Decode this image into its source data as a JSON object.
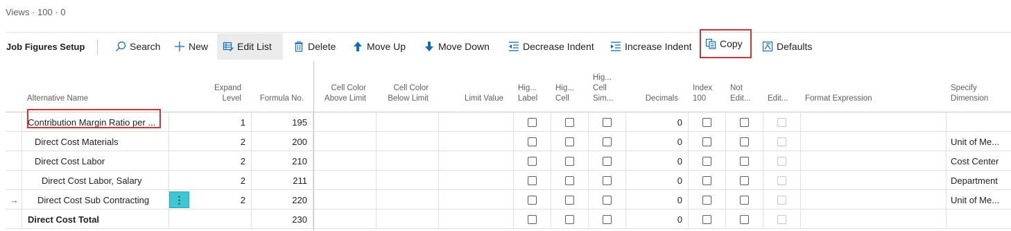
{
  "views": "Views · 100 · 0",
  "toolbar": {
    "title": "Job Figures Setup",
    "search": "Search",
    "new": "New",
    "edit_list": "Edit List",
    "delete": "Delete",
    "move_up": "Move Up",
    "move_down": "Move Down",
    "decrease_indent": "Decrease Indent",
    "increase_indent": "Increase Indent",
    "copy": "Copy",
    "defaults": "Defaults"
  },
  "columns": {
    "alt_name": "Alternative Name",
    "expand_level": [
      "Expand",
      "Level"
    ],
    "formula_no": "Formula No.",
    "cell_color_above": [
      "Cell Color",
      "Above Limit"
    ],
    "cell_color_below": [
      "Cell Color",
      "Below Limit"
    ],
    "limit_value": "Limit Value",
    "hig_label": [
      "Hig...",
      "Label"
    ],
    "hig_cell": [
      "Hig...",
      "Cell"
    ],
    "hig_cell_sim": [
      "Hig...",
      "Cell",
      "Sim..."
    ],
    "decimals": "Decimals",
    "index100": [
      "Index",
      "100"
    ],
    "not_edit": [
      "Not",
      "Edit..."
    ],
    "edit": "Edit...",
    "format_expression": "Format Expression",
    "specify_dimension": [
      "Specify",
      "Dimension"
    ]
  },
  "rows": [
    {
      "name": "Contribution Margin Ratio per ...",
      "level": "1",
      "formula": "195",
      "decimals": "0",
      "dimension": ""
    },
    {
      "name": "Direct Cost Materials",
      "level": "2",
      "formula": "200",
      "decimals": "0",
      "dimension": "Unit of Me..."
    },
    {
      "name": "Direct Cost Labor",
      "level": "2",
      "formula": "210",
      "decimals": "0",
      "dimension": "Cost Center"
    },
    {
      "name": "Direct Cost Labor, Salary",
      "level": "2",
      "formula": "211",
      "decimals": "0",
      "dimension": "Department"
    },
    {
      "name": "Direct Cost Sub Contracting",
      "level": "2",
      "formula": "220",
      "decimals": "0",
      "dimension": "Unit of Me..."
    },
    {
      "name": "Direct Cost Total",
      "level": "",
      "formula": "230",
      "decimals": "0",
      "dimension": ""
    }
  ],
  "row_marker": "→",
  "row_menu": "⋮"
}
